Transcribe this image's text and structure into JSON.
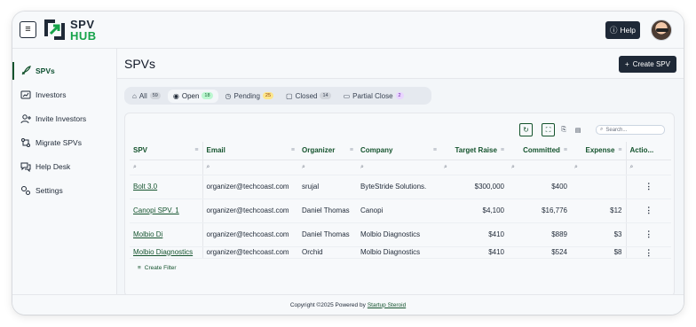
{
  "header": {
    "logo_line1": "SPV",
    "logo_line2": "HUB",
    "help_label": "Help"
  },
  "sidebar": {
    "items": [
      {
        "label": "SPVs",
        "icon": "rocket-icon"
      },
      {
        "label": "Investors",
        "icon": "investors-icon"
      },
      {
        "label": "Invite Investors",
        "icon": "add-user-icon"
      },
      {
        "label": "Migrate SPVs",
        "icon": "migrate-icon"
      },
      {
        "label": "Help Desk",
        "icon": "chat-icon"
      },
      {
        "label": "Settings",
        "icon": "gear-icon"
      }
    ]
  },
  "main": {
    "title": "SPVs",
    "create_label": "Create SPV",
    "tabs": [
      {
        "label": "All",
        "count": "59"
      },
      {
        "label": "Open",
        "count": "18"
      },
      {
        "label": "Pending",
        "count": "25"
      },
      {
        "label": "Closed",
        "count": "14"
      },
      {
        "label": "Partial Close",
        "count": "2"
      }
    ],
    "search_placeholder": "Search...",
    "columns": [
      "SPV",
      "Email",
      "Organizer",
      "Company",
      "Target Raise",
      "Committed",
      "Expense",
      "Actio..."
    ],
    "rows": [
      {
        "spv": "Bolt 3.0",
        "email": "organizer@techcoast.com",
        "organizer": "srujal",
        "company": "ByteStride Solutions.",
        "target": "$300,000",
        "committed": "$400",
        "expense": ""
      },
      {
        "spv": "Canopi SPV. 1",
        "email": "organizer@techcoast.com",
        "organizer": "Daniel Thomas",
        "company": "Canopi",
        "target": "$4,100",
        "committed": "$16,776",
        "expense": "$12"
      },
      {
        "spv": "Molbio Di",
        "email": "organizer@techcoast.com",
        "organizer": "Daniel Thomas",
        "company": "Molbio Diagnostics",
        "target": "$410",
        "committed": "$889",
        "expense": "$3"
      },
      {
        "spv": "Molbio Diagnostics",
        "email": "organizer@techcoast.com",
        "organizer": "Orchid",
        "company": "Molbio Diagnostics",
        "target": "$410",
        "committed": "$524",
        "expense": "$8"
      }
    ],
    "create_filter_label": "Create Filter"
  },
  "footer": {
    "text": "Copyright ©2025 Powered by",
    "link": "Startup Steroid"
  },
  "colors": {
    "accent": "#14532d",
    "brand_green": "#16a34a",
    "dark_button": "#1f2937"
  }
}
